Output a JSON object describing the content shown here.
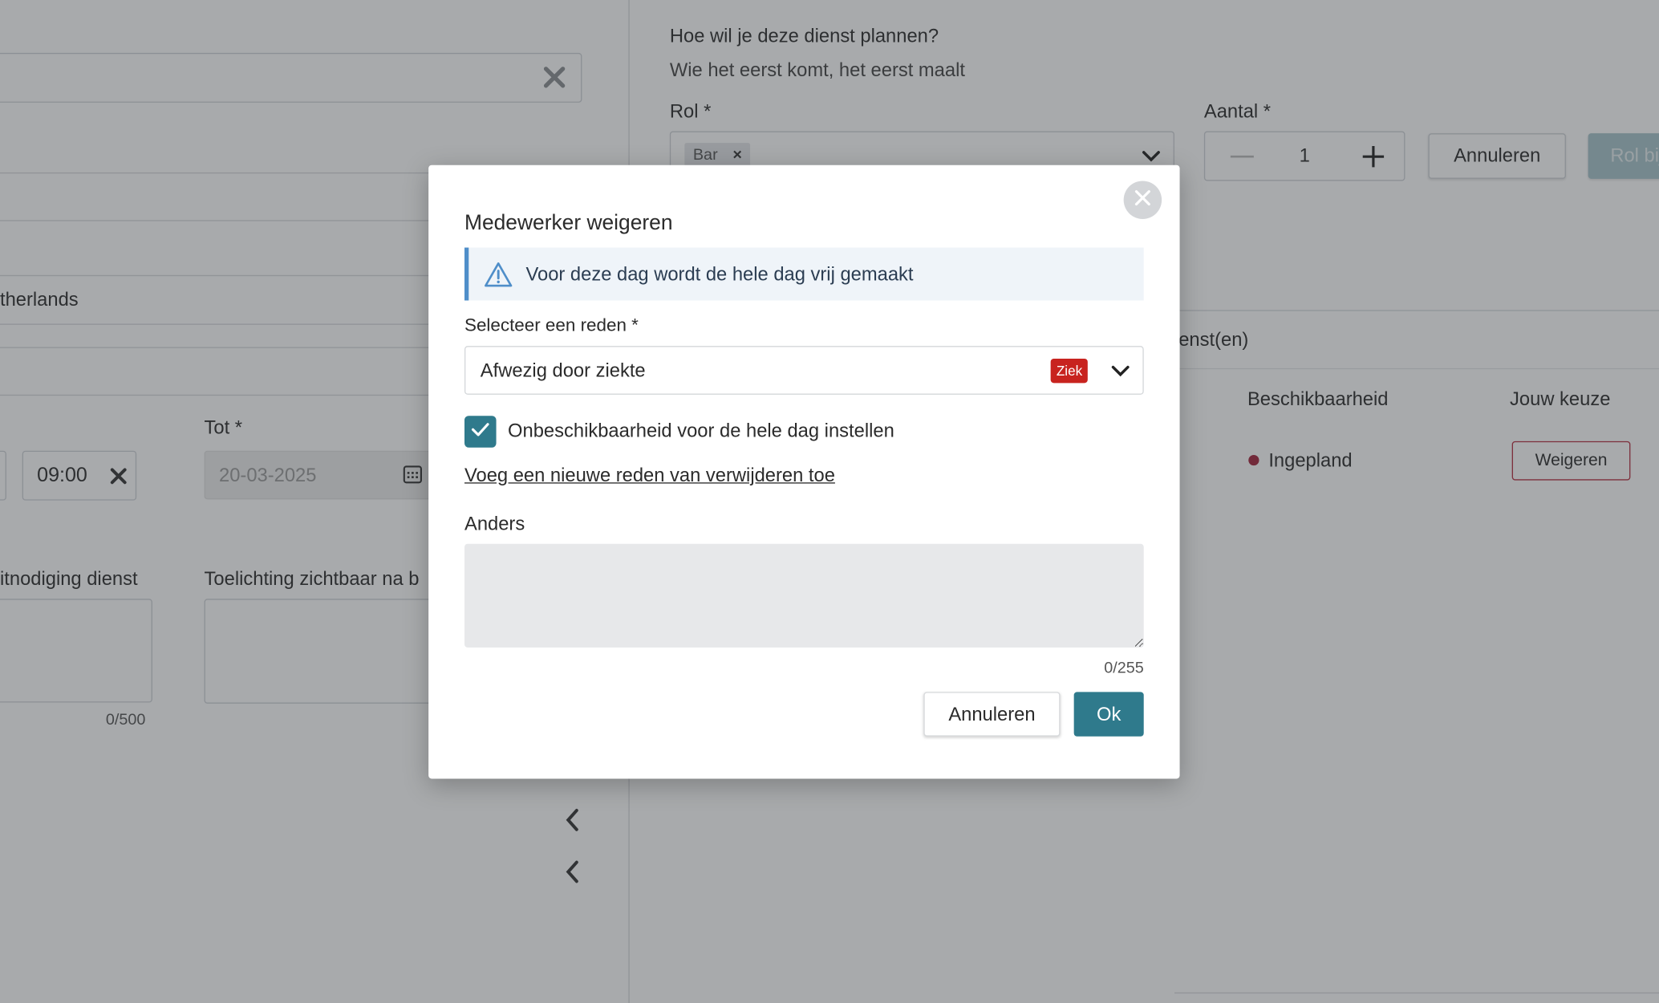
{
  "background": {
    "location_partial": "therlands",
    "tot_label": "Tot *",
    "time_value": "09:00",
    "date_value": "20-03-2025",
    "invitation_label_partial": "itnodiging dienst",
    "note_label_partial": "Toelichting zichtbaar na b",
    "note_counter": "0/500",
    "plan_question": "Hoe wil je deze dienst plannen?",
    "plan_answer": "Wie het eerst komt, het eerst maalt",
    "rol_label": "Rol *",
    "rol_chip": "Bar",
    "aantal_label": "Aantal *",
    "aantal_value": "1",
    "annuleren_label": "Annuleren",
    "rol_add_label_partial": "Rol bij",
    "diensten_partial": "ienst(en)",
    "col_beschikbaarheid": "Beschikbaarheid",
    "col_keuze": "Jouw keuze",
    "status_text": "Ingepland",
    "status_color": "#a3243b",
    "weigeren_label": "Weigeren"
  },
  "modal": {
    "title": "Medewerker weigeren",
    "alert_text": "Voor deze dag wordt de hele dag vrij gemaakt",
    "alert_icon": "warning-triangle-icon",
    "select_label": "Selecteer een reden *",
    "select_value": "Afwezig door ziekte",
    "select_badge": "Ziek",
    "badge_color": "#c8231f",
    "checkbox_checked": true,
    "checkbox_label": "Onbeschikbaarheid voor de hele dag instellen",
    "link_text": "Voeg een nieuwe reden van verwijderen toe",
    "anders_label": "Anders",
    "anders_value": "",
    "counter": "0/255",
    "cancel_label": "Annuleren",
    "ok_label": "Ok",
    "accent_color": "#2f7a8c"
  }
}
